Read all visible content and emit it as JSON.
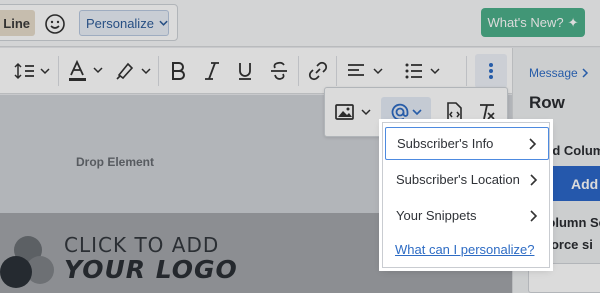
{
  "topbar": {
    "line_label": "Line",
    "personalize_label": "Personalize",
    "whats_new_label": "What's New?"
  },
  "toolbar": {
    "icons": [
      "line-height-icon",
      "text-color-icon",
      "highlight-icon",
      "bold-icon",
      "italic-icon",
      "underline-icon",
      "strikethrough-icon",
      "link-icon",
      "align-icon",
      "list-icon",
      "more-icon"
    ]
  },
  "editor": {
    "drop_text": "Drop Element",
    "logo_line1": "CLICK TO ADD",
    "logo_line2": "YOUR LOGO"
  },
  "sub_toolbar": {
    "icons": [
      "image-icon",
      "at-icon",
      "code-icon",
      "clear-format-icon"
    ]
  },
  "right_panel": {
    "breadcrumb": "Message",
    "title": "Row",
    "add_column_heading": "Add Colum",
    "add_button": "Add",
    "column_settings": "Column Set",
    "force_label": "Force si"
  },
  "dropdown": {
    "items": [
      {
        "label": "Subscriber's Info"
      },
      {
        "label": "Subscriber's Location"
      },
      {
        "label": "Your Snippets"
      }
    ],
    "help_link": "What can I personalize?"
  },
  "colors": {
    "accent": "#2e6cc4",
    "add_button": "#2c67c9",
    "whats_new": "#4caf8a",
    "active_border": "#4d8ae0"
  }
}
